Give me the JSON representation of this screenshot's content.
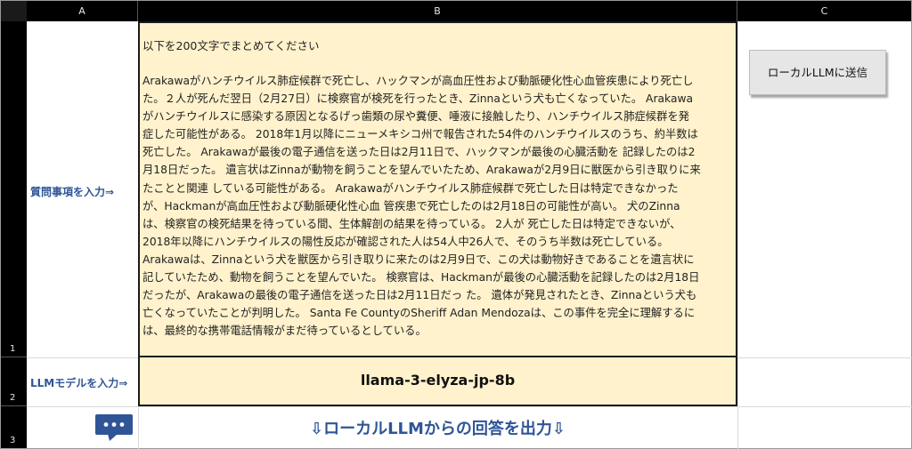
{
  "columns": [
    "A",
    "B",
    "C"
  ],
  "rows": [
    "1",
    "2",
    "3"
  ],
  "cells": {
    "a1_label": "質問事項を入力⇒",
    "a2_label": "LLMモデルを入力⇒",
    "prompt_heading": "以下を200文字でまとめてください",
    "prompt_lines": [
      "Arakawaがハンチウイルス肺症候群で死亡し、ハックマンが高血圧性および動脈硬化性心血管疾患により死亡し",
      "た。２人が死んだ翌日（2月27日）に検察官が検死を行ったとき、Zinnaという犬も亡くなっていた。 Arakawa",
      "がハンチウイルスに感染する原因となるげっ歯類の尿や糞便、唾液に接触したり、ハンチウイルス肺症候群を発",
      "症した可能性がある。 2018年1月以降にニューメキシコ州で報告された54件のハンチウイルスのうち、約半数は",
      "死亡した。 Arakawaが最後の電子通信を送った日は2月11日で、ハックマンが最後の心臓活動を 記録したのは2",
      "月18日だった。 遺言状はZinnaが動物を飼うことを望んでいたため、Arakawaが2月9日に獣医から引き取りに来",
      "たことと関連 している可能性がある。 Arakawaがハンチウイルス肺症候群で死亡した日は特定できなかった",
      "が、Hackmanが高血圧性および動脈硬化性心血 管疾患で死亡したのは2月18日の可能性が高い。 犬のZinna",
      "は、検察官の検死結果を待っている間、生体解剖の結果を待っている。 2人が 死亡した日は特定できないが、",
      "2018年以降にハンチウイルスの陽性反応が確認された人は54人中26人で、そのうち半数は死亡している。",
      "Arakawaは、Zinnaという犬を獣医から引き取りに来たのは2月9日で、この犬は動物好きであることを遺言状に",
      "記していたため、動物を飼うことを望んでいた。 検察官は、Hackmanが最後の心臓活動を記録したのは2月18日",
      "だったが、Arakawaの最後の電子通信を送った日は2月11日だっ た。 遺体が発見されたとき、Zinnaという犬も",
      "亡くなっていたことが判明した。 Santa Fe CountyのSheriff Adan Mendozaは、この事件を完全に理解するに",
      "は、最終的な携帯電話情報がまだ待っているとしている。"
    ],
    "model_name": "llama-3-elyza-jp-8b",
    "output_label": "⇩ローカルLLMからの回答を出力⇩"
  },
  "button": {
    "label": "ローカルLLMに送信"
  },
  "icons": {
    "chat": "speech-bubble-icon"
  },
  "colors": {
    "input_fill": "#fff2cc",
    "label_blue": "#2f5597",
    "header_bg": "#000000",
    "icon_blue": "#2f5597"
  }
}
